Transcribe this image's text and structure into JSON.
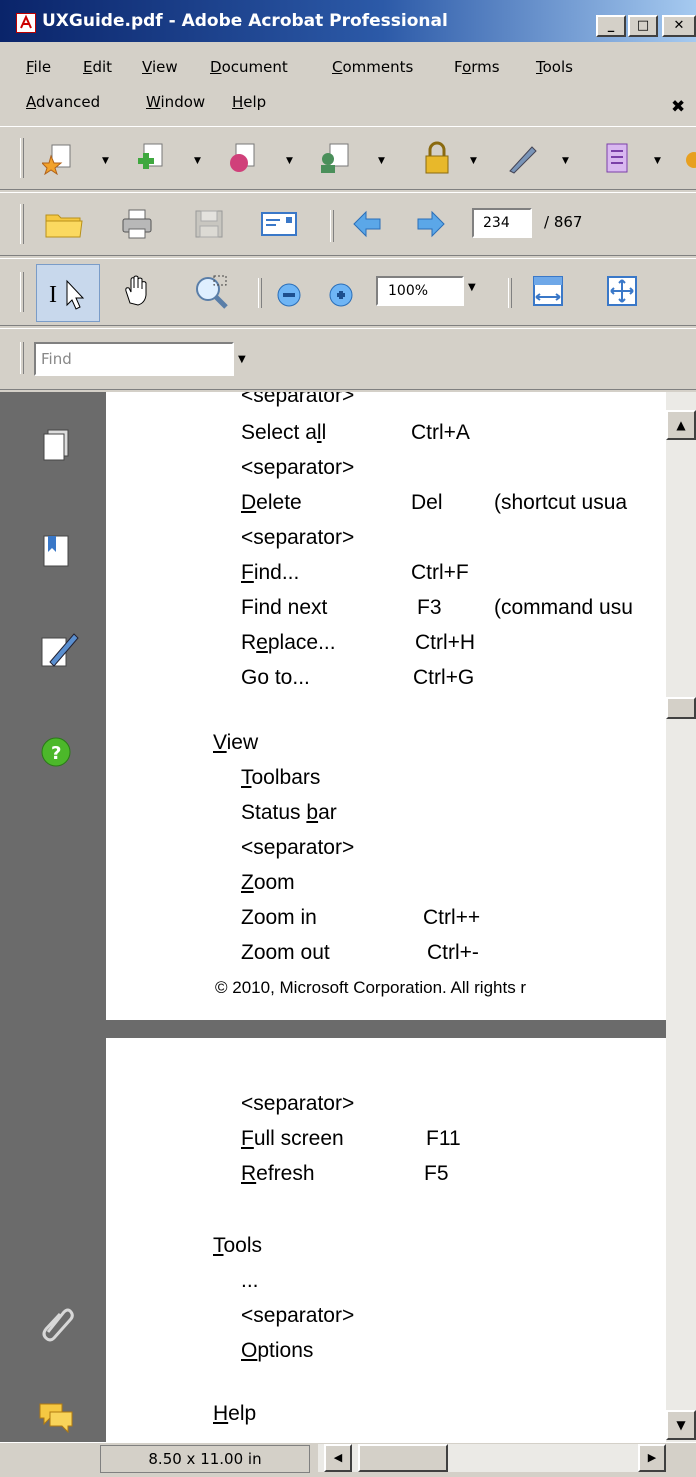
{
  "window": {
    "title": "UXGuide.pdf - Adobe Acrobat Professional",
    "controls": {
      "minimize": "_",
      "maximize": "□",
      "close": "✕"
    }
  },
  "menubar": {
    "items": [
      {
        "label": "File",
        "ul": "F",
        "rest": "ile"
      },
      {
        "label": "Edit",
        "ul": "E",
        "rest": "dit"
      },
      {
        "label": "View",
        "ul": "V",
        "rest": "iew"
      },
      {
        "label": "Document",
        "ul": "D",
        "rest": "ocument"
      },
      {
        "label": "Comments",
        "ul": "C",
        "rest": "omments"
      },
      {
        "label": "Forms",
        "pre": "F",
        "ul": "o",
        "rest": "rms"
      },
      {
        "label": "Tools",
        "ul": "T",
        "rest": "ools"
      },
      {
        "label": "Advanced",
        "ul": "A",
        "rest": "dvanced"
      },
      {
        "label": "Window",
        "ul": "W",
        "rest": "indow"
      },
      {
        "label": "Help",
        "ul": "H",
        "rest": "elp"
      }
    ],
    "close_glyph": "✖"
  },
  "toolbar": {
    "page_number": "234",
    "page_total": "/ 867",
    "zoom": "100%",
    "find_placeholder": "Find"
  },
  "document": {
    "page1": [
      {
        "text": "<separator>"
      },
      {
        "label": "Select all",
        "pre": "Select a",
        "ul": "l",
        "rest": "l",
        "shortcut": "Ctrl+A"
      },
      {
        "text": "<separator>"
      },
      {
        "pre": "",
        "ul": "D",
        "rest": "elete",
        "shortcut": "Del",
        "note": "(shortcut usua"
      },
      {
        "text": "<separator>"
      },
      {
        "pre": "",
        "ul": "F",
        "rest": "ind...",
        "shortcut": "Ctrl+F"
      },
      {
        "pre": "Find next",
        "ul": "",
        "rest": "",
        "shortcut": "F3",
        "note": "(command usu"
      },
      {
        "pre": "R",
        "ul": "e",
        "rest": "place...",
        "shortcut": "Ctrl+H"
      },
      {
        "pre": "Go to...",
        "ul": "",
        "rest": "",
        "shortcut": "Ctrl+G"
      }
    ],
    "view_heading": {
      "ul": "V",
      "rest": "iew"
    },
    "view_items": [
      {
        "pre": "",
        "ul": "T",
        "rest": "oolbars"
      },
      {
        "pre": "Status ",
        "ul": "b",
        "rest": "ar"
      },
      {
        "pre": "<separator>",
        "ul": "",
        "rest": ""
      },
      {
        "pre": "",
        "ul": "Z",
        "rest": "oom"
      },
      {
        "pre": "Zoom in",
        "ul": "",
        "rest": "",
        "shortcut": "Ctrl++"
      },
      {
        "pre": "Zoom out",
        "ul": "",
        "rest": "",
        "shortcut": "Ctrl+-"
      }
    ],
    "copyright": "© 2010, Microsoft Corporation. All rights r",
    "page2_items": [
      {
        "pre": "<separator>",
        "ul": "",
        "rest": ""
      },
      {
        "pre": "",
        "ul": "F",
        "rest": "ull screen",
        "shortcut": "F11"
      },
      {
        "pre": "",
        "ul": "R",
        "rest": "efresh",
        "shortcut": "F5"
      }
    ],
    "tools_heading": {
      "ul": "T",
      "rest": "ools"
    },
    "tools_items": [
      {
        "pre": "...",
        "ul": "",
        "rest": ""
      },
      {
        "pre": "<separator>",
        "ul": "",
        "rest": ""
      },
      {
        "pre": "",
        "ul": "O",
        "rest": "ptions"
      }
    ],
    "help_heading": {
      "ul": "H",
      "rest": "elp"
    }
  },
  "status": {
    "page_size": "8.50 x 11.00 in"
  },
  "colors": {
    "titlebar": "#0a246a",
    "nav": "#6b6b6b",
    "chrome": "#d4d0c8"
  }
}
